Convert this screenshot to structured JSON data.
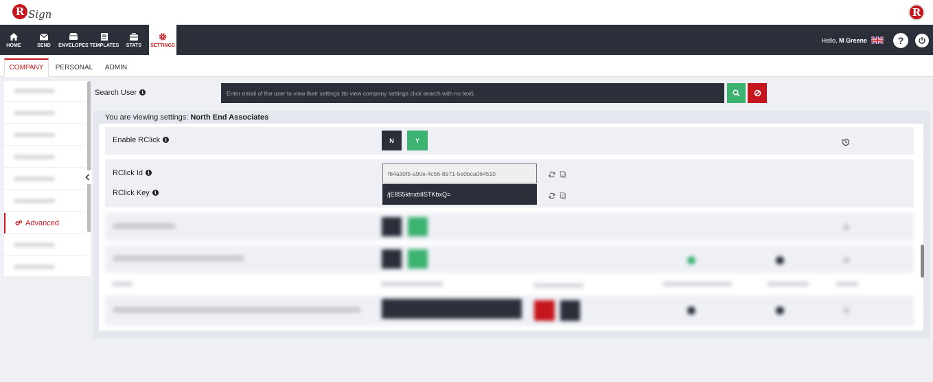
{
  "app": {
    "name": "RSign",
    "logo_letter": "R",
    "logo_script": "Sign"
  },
  "nav": {
    "items": [
      {
        "label": "HOME",
        "icon": "home-icon"
      },
      {
        "label": "SEND",
        "icon": "envelope-icon"
      },
      {
        "label": "ENVELOPES",
        "icon": "envelopes-icon"
      },
      {
        "label": "TEMPLATES",
        "icon": "templates-icon"
      },
      {
        "label": "STATS",
        "icon": "briefcase-icon"
      },
      {
        "label": "SETTINGS",
        "icon": "gear-icon"
      }
    ],
    "greeting_prefix": "Hello,",
    "user_name": "M Greene",
    "help_label": "?"
  },
  "tabs": [
    {
      "label": "COMPANY"
    },
    {
      "label": "PERSONAL"
    },
    {
      "label": "ADMIN"
    }
  ],
  "sidebar": {
    "active_label": "Advanced",
    "active_icon": "gears-icon"
  },
  "search": {
    "label": "Search User",
    "placeholder": "Enter email of the user to view their settings (to view company settings click search with no text)."
  },
  "viewing": {
    "prefix": "You are viewing settings:",
    "company": "North End Associates"
  },
  "settings": {
    "rclick": {
      "label": "Enable RClick",
      "no_label": "N",
      "yes_label": "Y"
    },
    "rclick_id": {
      "label": "RClick Id",
      "value": "f64a30f5-a90e-4c56-8971-5e0bca064510"
    },
    "rclick_key": {
      "label": "RClick Key",
      "value": "/jE8S5ktnxbIISTKbxQ="
    }
  },
  "colors": {
    "accent": "#c4161c",
    "dark": "#2a2f3a",
    "green": "#3cb371"
  }
}
